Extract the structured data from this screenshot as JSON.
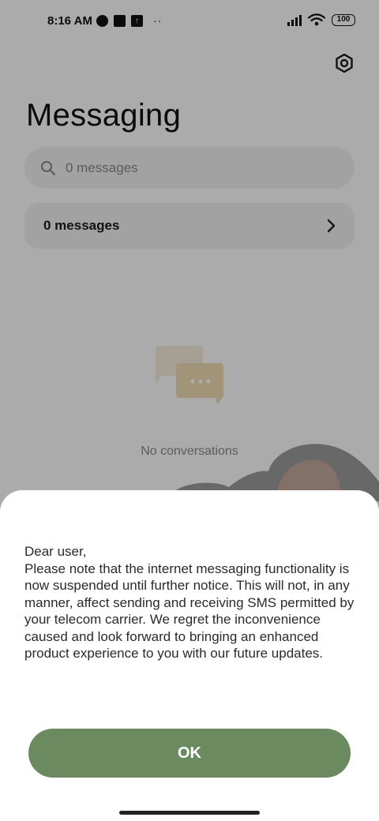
{
  "status_bar": {
    "time": "8:16 AM",
    "notification_dots": "··",
    "battery": "100"
  },
  "header": {
    "title": "Messaging",
    "settings_icon": "gear-icon"
  },
  "search": {
    "placeholder": "0 messages",
    "icon": "search-icon"
  },
  "messages_row": {
    "label": "0 messages",
    "icon": "chevron-right-icon"
  },
  "empty_state": {
    "text": "No conversations",
    "icon": "chat-bubbles-icon"
  },
  "dialog": {
    "greeting": "Dear user,",
    "body": "Please note that the internet messaging functionality is now suspended until further notice. This will not, in any manner, affect sending and receiving SMS permitted by your telecom carrier. We regret the inconvenience caused and look forward to bringing an enhanced product experience to you with our future updates.",
    "ok_label": "OK"
  },
  "colors": {
    "accent": "#6b8a5f",
    "scrim": "rgba(0,0,0,0.33)",
    "card": "#f2f2f2"
  }
}
